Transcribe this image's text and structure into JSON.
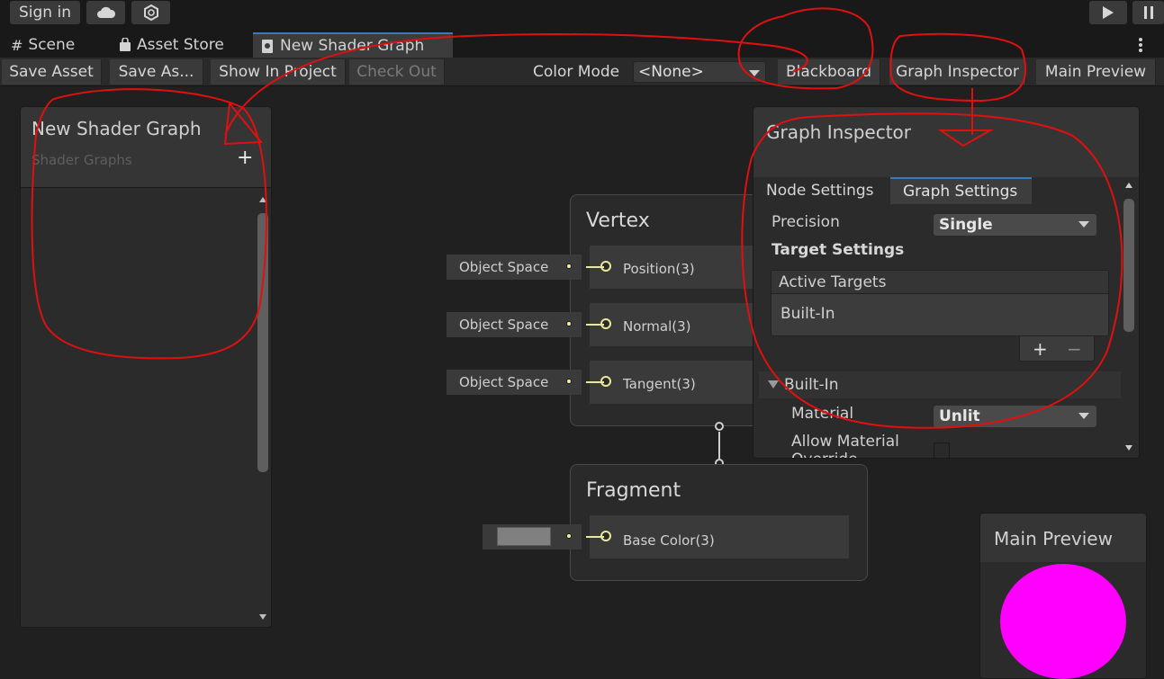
{
  "topbar": {
    "sign_in": "Sign in",
    "cloud_icon": "cloud-icon",
    "collab_icon": "hexagon-icon",
    "play_icon": "play-icon",
    "pause_icon": "pause-icon"
  },
  "tabs": [
    {
      "label": "Scene",
      "icon": "grid-icon"
    },
    {
      "label": "Asset Store",
      "icon": "bag-icon"
    },
    {
      "label": "New Shader Graph",
      "icon": "shader-graph-icon"
    }
  ],
  "toolbar": {
    "save_asset": "Save Asset",
    "save_as": "Save As...",
    "show_in_project": "Show In Project",
    "check_out": "Check Out",
    "color_mode_label": "Color Mode",
    "color_mode_value": "<None>",
    "blackboard": "Blackboard",
    "graph_inspector": "Graph Inspector",
    "main_preview": "Main Preview"
  },
  "blackboard": {
    "title": "New Shader Graph",
    "subtitle": "Shader Graphs",
    "add_symbol": "+"
  },
  "vertex": {
    "title": "Vertex",
    "ports": [
      {
        "field": "Object Space",
        "label": "Position(3)"
      },
      {
        "field": "Object Space",
        "label": "Normal(3)"
      },
      {
        "field": "Object Space",
        "label": "Tangent(3)"
      }
    ]
  },
  "fragment": {
    "title": "Fragment",
    "ports": [
      {
        "label": "Base Color(3)",
        "swatch": "#808080"
      }
    ]
  },
  "inspector": {
    "title": "Graph Inspector",
    "tab_node": "Node Settings",
    "tab_graph": "Graph Settings",
    "precision_label": "Precision",
    "precision_value": "Single",
    "target_settings": "Target Settings",
    "active_targets": "Active Targets",
    "target_item": "Built-In",
    "add_symbol": "+",
    "remove_symbol": "−",
    "builtin_section": "Built-In",
    "material_label": "Material",
    "material_value": "Unlit",
    "allow_override": "Allow Material Override"
  },
  "preview": {
    "title": "Main Preview",
    "sphere_color": "#ff00ff"
  },
  "colors": {
    "accent": "#3a79bb",
    "annotation": "#e01010",
    "wire": "#e8e89a"
  }
}
